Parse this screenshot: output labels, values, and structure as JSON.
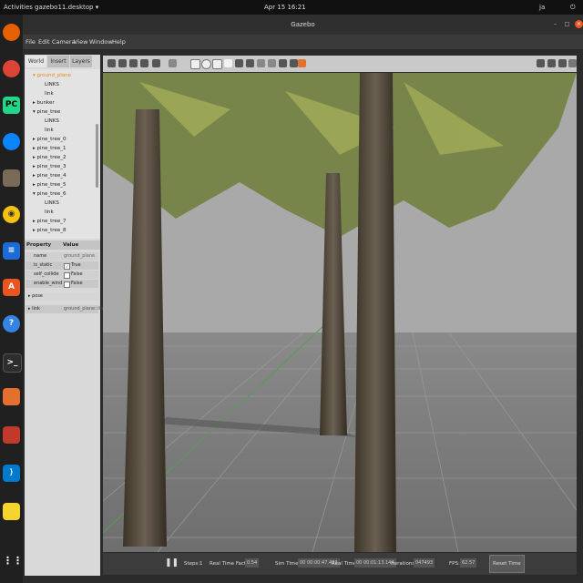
{
  "topbar": {
    "activities": "Activities",
    "app_menu": "gazebo11.desktop ▾",
    "datetime": "Apr 15  16:21",
    "user": "ja"
  },
  "window": {
    "title": "Gazebo"
  },
  "menu": [
    "File",
    "Edit",
    "Camera",
    "View",
    "Window",
    "Help"
  ],
  "tabs": [
    "World",
    "Insert",
    "Layers"
  ],
  "tree": [
    {
      "label": "▾ ground_plane",
      "selected": true
    },
    {
      "label": "LINKS"
    },
    {
      "label": "link"
    },
    {
      "label": "▸ bunker"
    },
    {
      "label": "▾ pine_tree"
    },
    {
      "label": "LINKS"
    },
    {
      "label": "link"
    },
    {
      "label": "▸ pine_tree_0"
    },
    {
      "label": "▸ pine_tree_1"
    },
    {
      "label": "▸ pine_tree_2"
    },
    {
      "label": "▸ pine_tree_3"
    },
    {
      "label": "▸ pine_tree_4"
    },
    {
      "label": "▸ pine_tree_5"
    },
    {
      "label": "▾ pine_tree_6"
    },
    {
      "label": "LINKS"
    },
    {
      "label": "link"
    },
    {
      "label": "▸ pine_tree_7"
    },
    {
      "label": "▸ pine_tree_8"
    }
  ],
  "properties": {
    "header_property": "Property",
    "header_value": "Value",
    "rows": [
      {
        "name": "name",
        "value": "ground_plane"
      },
      {
        "name": "is_static",
        "value": "True",
        "checked": true
      },
      {
        "name": "self_collide",
        "value": "False",
        "checked": false
      },
      {
        "name": "enable_wind",
        "value": "False",
        "checked": false
      },
      {
        "name": "▸ pose",
        "value": ""
      },
      {
        "name": "▸ link",
        "value": "ground_plane::link"
      }
    ]
  },
  "status": {
    "steps_label": "Steps:",
    "steps_value": "1",
    "rtf_label": "Real Time Factor:",
    "rtf_value": "0.54",
    "sim_time_label": "Sim Time:",
    "sim_time_value": "00 00:00:47.493",
    "real_time_label": "Real Time:",
    "real_time_value": "00 00:01:13.144",
    "iterations_label": "Iterations:",
    "iterations_value": "047493",
    "fps_label": "FPS:",
    "fps_value": "62.57",
    "reset_label": "Reset Time"
  },
  "dock_icons": [
    "firefox-icon",
    "chrome-icon",
    "pycharm-icon",
    "thunderbird-icon",
    "files-icon",
    "rhythmbox-icon",
    "writer-icon",
    "software-center-icon",
    "help-icon",
    "terminal-icon",
    "gazebo-icon",
    "system-monitor-icon",
    "vscode-icon",
    "sticky-notes-icon",
    "app-grid-icon"
  ]
}
